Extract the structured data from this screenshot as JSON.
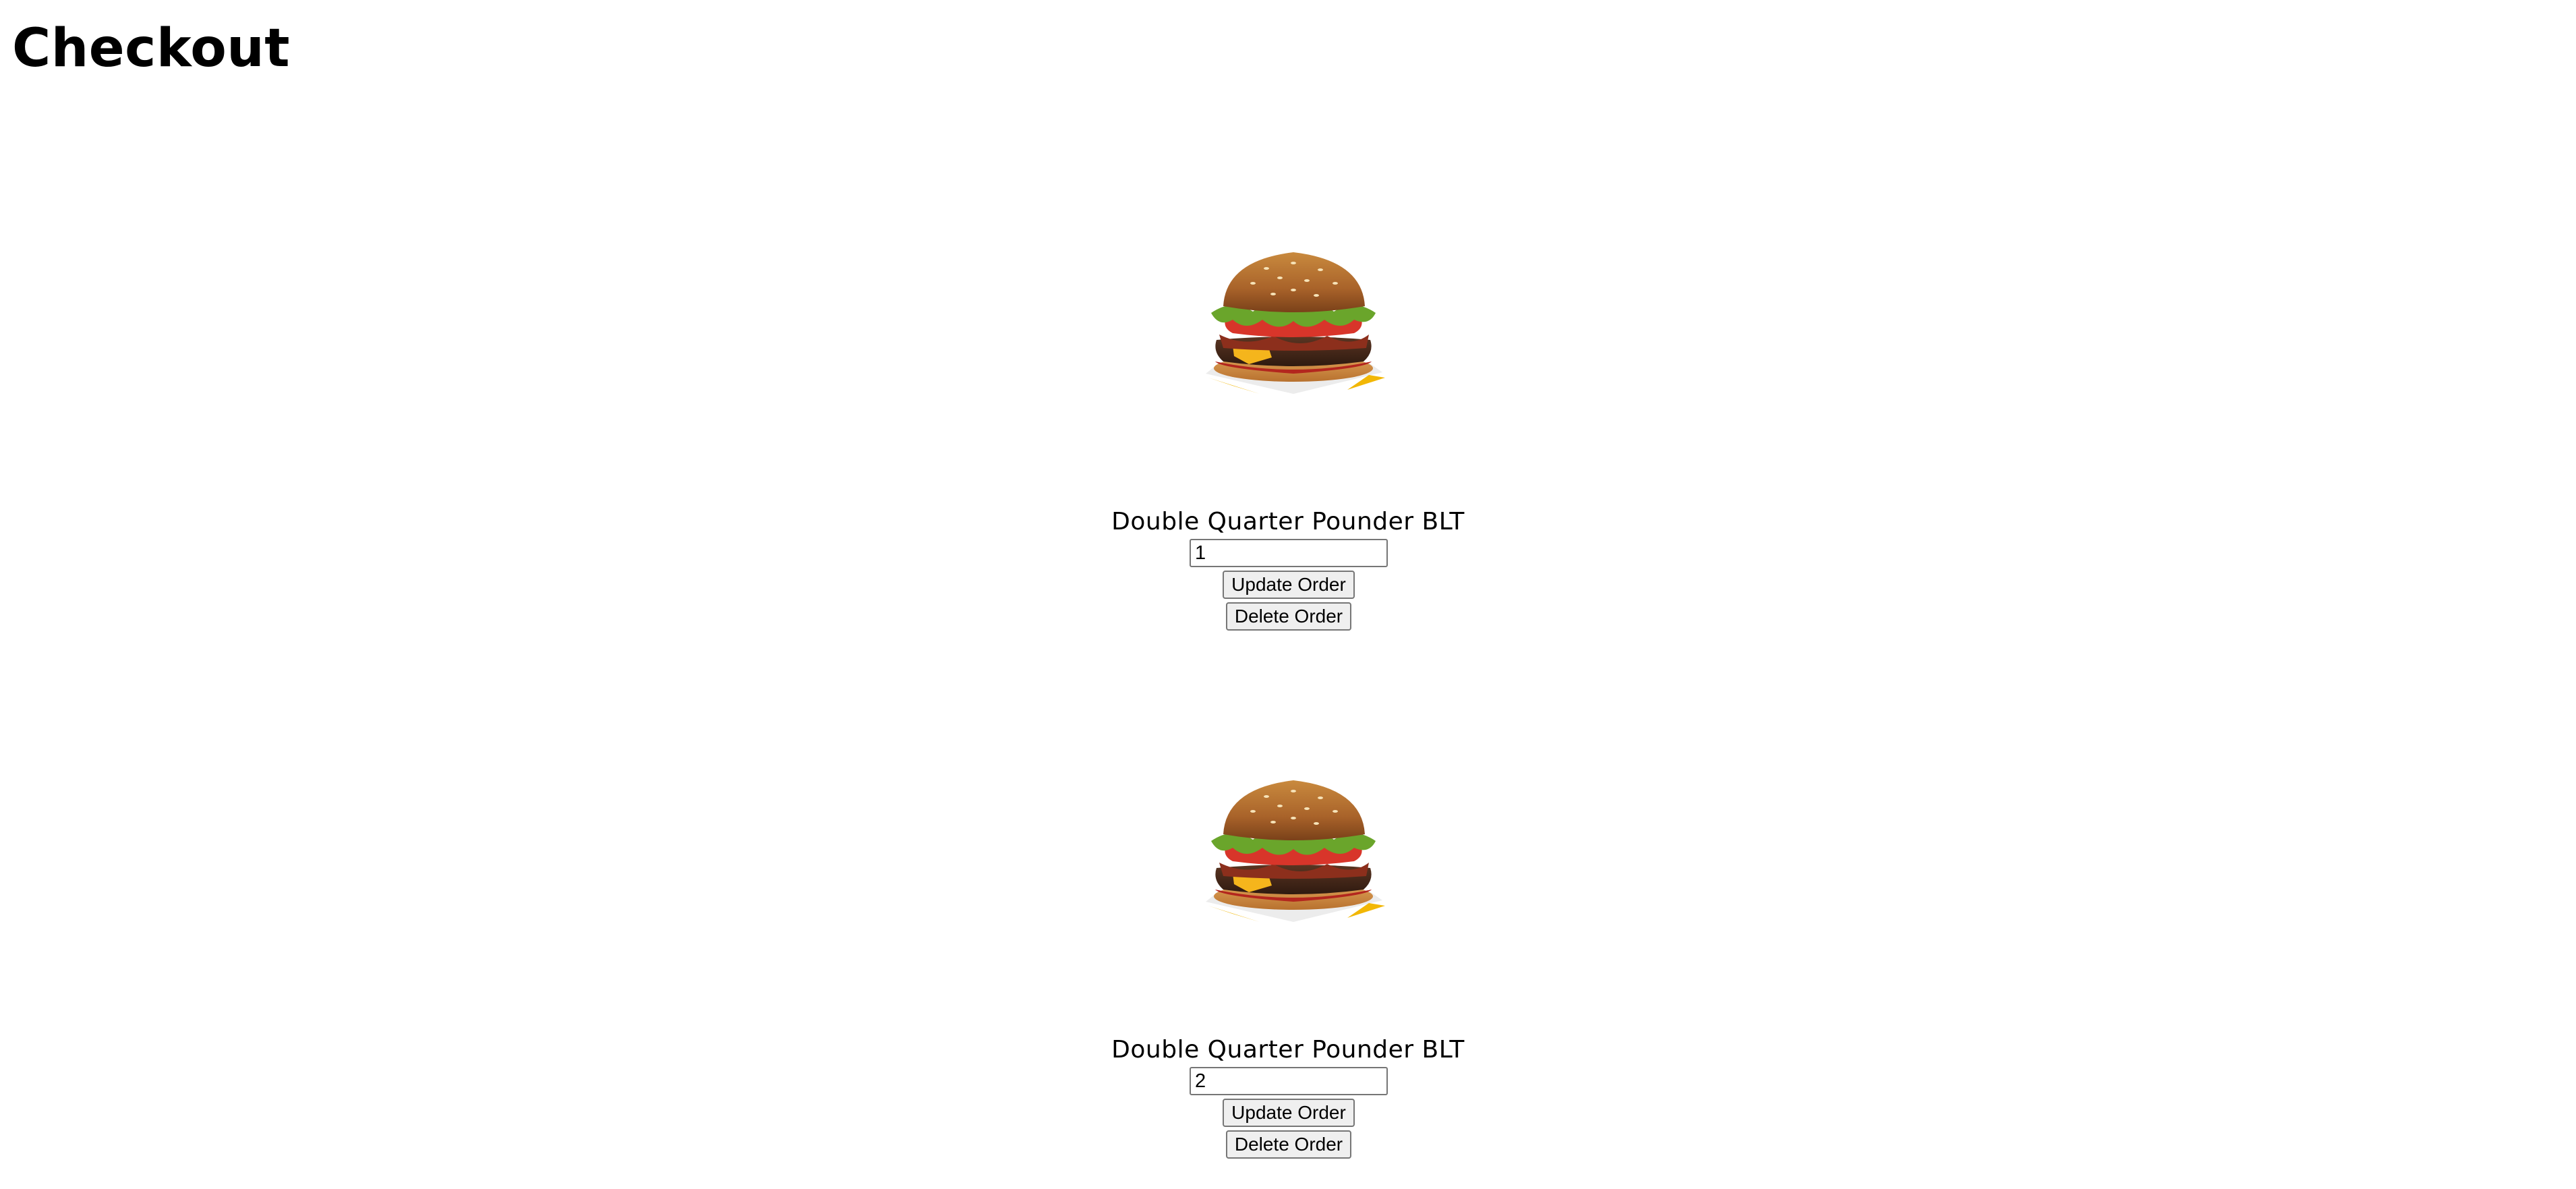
{
  "page": {
    "title": "Checkout"
  },
  "orders": [
    {
      "image_alt": "Double Quarter Pounder BLT burger",
      "name": "Double Quarter Pounder BLT",
      "quantity": "1",
      "update_label": "Update Order",
      "delete_label": "Delete Order"
    },
    {
      "image_alt": "Double Quarter Pounder BLT burger",
      "name": "Double Quarter Pounder BLT",
      "quantity": "2",
      "update_label": "Update Order",
      "delete_label": "Delete Order"
    }
  ]
}
